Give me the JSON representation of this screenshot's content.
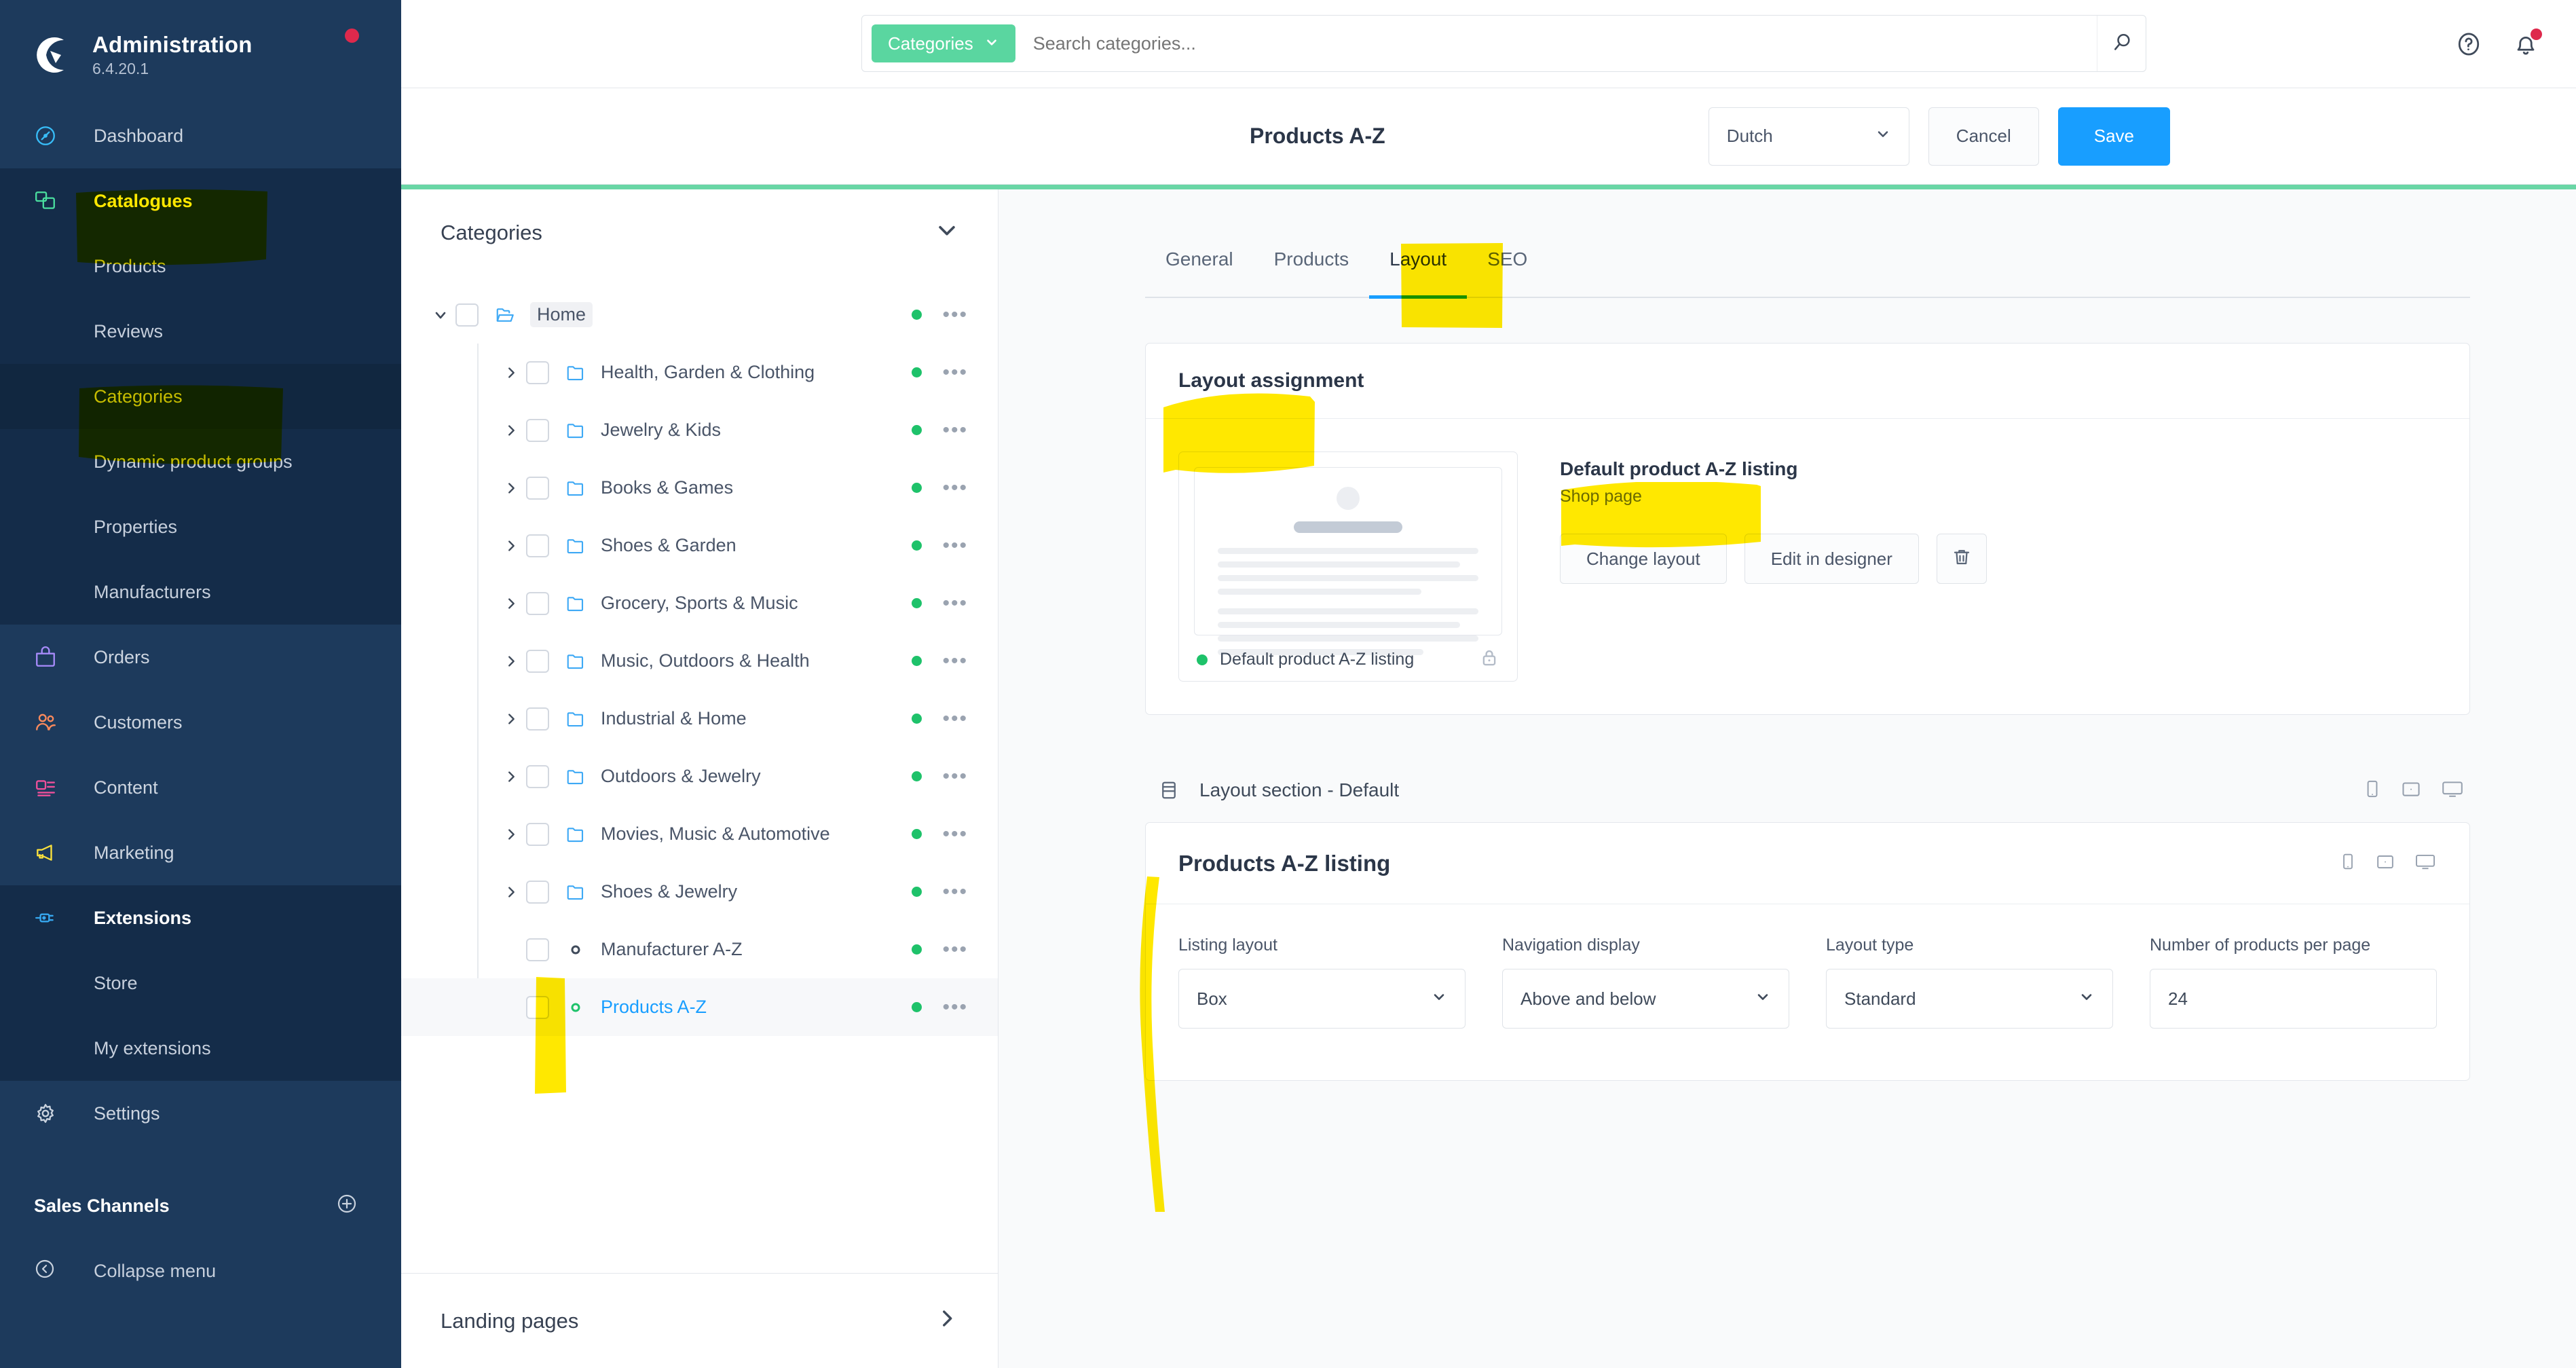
{
  "sidebar": {
    "brand": {
      "title": "Administration",
      "version": "6.4.20.1"
    },
    "items": [
      {
        "label": "Dashboard",
        "icon": "gauge-icon"
      },
      {
        "label": "Catalogues",
        "icon": "catalogue-icon"
      },
      {
        "label": "Products",
        "icon": ""
      },
      {
        "label": "Reviews",
        "icon": ""
      },
      {
        "label": "Categories",
        "icon": ""
      },
      {
        "label": "Dynamic product groups",
        "icon": ""
      },
      {
        "label": "Properties",
        "icon": ""
      },
      {
        "label": "Manufacturers",
        "icon": ""
      },
      {
        "label": "Orders",
        "icon": "bag-icon"
      },
      {
        "label": "Customers",
        "icon": "users-icon"
      },
      {
        "label": "Content",
        "icon": "content-icon"
      },
      {
        "label": "Marketing",
        "icon": "megaphone-icon"
      },
      {
        "label": "Extensions",
        "icon": "plug-icon"
      },
      {
        "label": "Store",
        "icon": ""
      },
      {
        "label": "My extensions",
        "icon": ""
      },
      {
        "label": "Settings",
        "icon": "gear-icon"
      }
    ],
    "sales_channels_label": "Sales Channels",
    "collapse_label": "Collapse menu"
  },
  "topbar": {
    "scope_label": "Categories",
    "search_placeholder": "Search categories...",
    "search_value": ""
  },
  "pagehead": {
    "title": "Products A-Z",
    "language": "Dutch",
    "cancel_label": "Cancel",
    "save_label": "Save"
  },
  "categories_panel": {
    "title": "Categories",
    "landing_pages_label": "Landing pages",
    "tree": [
      {
        "label": "Home",
        "depth": 0,
        "type": "folder-open",
        "expanded": true,
        "has_children": true,
        "active": true,
        "status": "#1ec26a"
      },
      {
        "label": "Health, Garden & Clothing",
        "depth": 1,
        "type": "folder",
        "expanded": false,
        "has_children": true,
        "active": false,
        "status": "#1ec26a"
      },
      {
        "label": "Jewelry & Kids",
        "depth": 1,
        "type": "folder",
        "expanded": false,
        "has_children": true,
        "active": false,
        "status": "#1ec26a"
      },
      {
        "label": "Books & Games",
        "depth": 1,
        "type": "folder",
        "expanded": false,
        "has_children": true,
        "active": false,
        "status": "#1ec26a"
      },
      {
        "label": "Shoes & Garden",
        "depth": 1,
        "type": "folder",
        "expanded": false,
        "has_children": true,
        "active": false,
        "status": "#1ec26a"
      },
      {
        "label": "Grocery, Sports & Music",
        "depth": 1,
        "type": "folder",
        "expanded": false,
        "has_children": true,
        "active": false,
        "status": "#1ec26a"
      },
      {
        "label": "Music, Outdoors & Health",
        "depth": 1,
        "type": "folder",
        "expanded": false,
        "has_children": true,
        "active": false,
        "status": "#1ec26a"
      },
      {
        "label": "Industrial & Home",
        "depth": 1,
        "type": "folder",
        "expanded": false,
        "has_children": true,
        "active": false,
        "status": "#1ec26a"
      },
      {
        "label": "Outdoors & Jewelry",
        "depth": 1,
        "type": "folder",
        "expanded": false,
        "has_children": true,
        "active": false,
        "status": "#1ec26a"
      },
      {
        "label": "Movies, Music & Automotive",
        "depth": 1,
        "type": "folder",
        "expanded": false,
        "has_children": true,
        "active": false,
        "status": "#1ec26a"
      },
      {
        "label": "Shoes & Jewelry",
        "depth": 1,
        "type": "folder",
        "expanded": false,
        "has_children": true,
        "active": false,
        "status": "#1ec26a"
      },
      {
        "label": "Manufacturer A-Z",
        "depth": 1,
        "type": "link",
        "expanded": false,
        "has_children": false,
        "active": false,
        "status": "#1ec26a"
      },
      {
        "label": "Products A-Z",
        "depth": 1,
        "type": "link",
        "expanded": false,
        "has_children": false,
        "active": false,
        "selected": true,
        "status": "#1ec26a"
      }
    ]
  },
  "tabs": [
    {
      "label": "General",
      "active": false
    },
    {
      "label": "Products",
      "active": false
    },
    {
      "label": "Layout",
      "active": true
    },
    {
      "label": "SEO",
      "active": false
    }
  ],
  "layout_assignment": {
    "card_title": "Layout assignment",
    "thumb_name": "Default product A-Z listing",
    "assigned_title": "Default product A-Z listing",
    "assigned_subtitle": "Shop page",
    "change_layout_label": "Change layout",
    "edit_in_designer_label": "Edit in designer",
    "delete_icon": "trash-icon"
  },
  "layout_section": {
    "header": "Layout section - Default",
    "block_title": "Products A-Z listing",
    "fields": [
      {
        "label": "Listing layout",
        "value": "Box",
        "type": "select"
      },
      {
        "label": "Navigation display",
        "value": "Above and below",
        "type": "select"
      },
      {
        "label": "Layout type",
        "value": "Standard",
        "type": "select"
      },
      {
        "label": "Number of products per page",
        "value": "24",
        "type": "number"
      }
    ],
    "device_icons": [
      "mobile-icon",
      "tablet-icon",
      "desktop-icon"
    ]
  },
  "colors": {
    "sidebar_bg": "#1d3a5c",
    "accent_blue": "#189eff",
    "accent_green": "#5ad6a0",
    "status_green": "#1ec26a",
    "notify_red": "#de294c",
    "highlighter_yellow": "#ffe800"
  },
  "annotations": {
    "highlights": [
      "Catalogues",
      "Categories",
      "Products A-Z tree marker",
      "Layout tab",
      "Layout assignment",
      "Default product A-Z listing / Shop page",
      "Products A-Z listing left stroke"
    ]
  }
}
